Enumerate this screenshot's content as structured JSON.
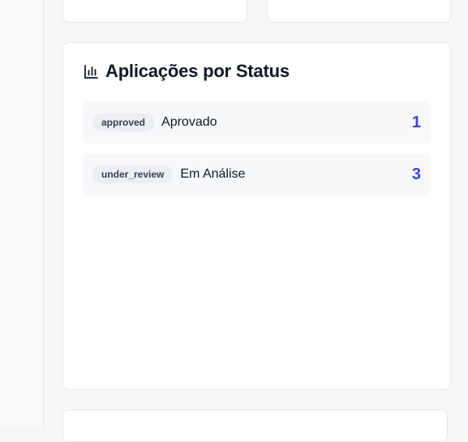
{
  "panel": {
    "title": "Aplicações por Status",
    "icon": "bar-chart-icon",
    "accent_color": "#4046c8",
    "rows": [
      {
        "key": "approved",
        "label": "Aprovado",
        "count": "1"
      },
      {
        "key": "under_review",
        "label": "Em Análise",
        "count": "3"
      }
    ]
  }
}
